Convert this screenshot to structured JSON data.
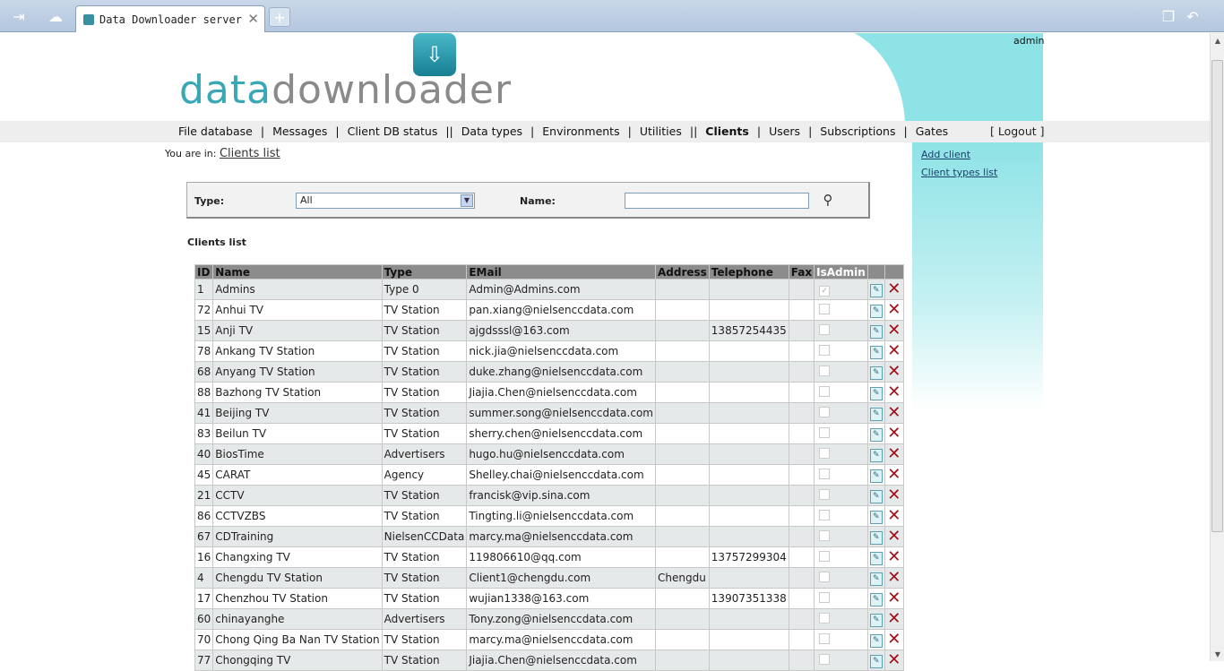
{
  "browser": {
    "tab_title": "Data Downloader server",
    "tab_close": "✕",
    "new_tab": "+"
  },
  "header": {
    "logo_part1": "data",
    "logo_part2": "downloader",
    "user": "admin"
  },
  "nav": {
    "items": [
      {
        "label": "File database",
        "sep": "|"
      },
      {
        "label": "Messages",
        "sep": "|"
      },
      {
        "label": "Client DB status",
        "sep": "||"
      },
      {
        "label": "Data types",
        "sep": "|"
      },
      {
        "label": "Environments",
        "sep": "|"
      },
      {
        "label": "Utilities",
        "sep": "||"
      },
      {
        "label": "Clients",
        "sep": "|"
      },
      {
        "label": "Users",
        "sep": "|"
      },
      {
        "label": "Subscriptions",
        "sep": "|"
      },
      {
        "label": "Gates",
        "sep": ""
      }
    ],
    "active": "Clients",
    "logout": "[ Logout ]"
  },
  "sidebar": {
    "add_client": "Add client",
    "client_types": "Client types list"
  },
  "breadcrumb": {
    "prefix": "You are in:",
    "current": "Clients list"
  },
  "filter": {
    "type_label": "Type:",
    "type_value": "All",
    "name_label": "Name:",
    "name_value": ""
  },
  "list_title": "Clients list",
  "table": {
    "columns": [
      "ID",
      "Name",
      "Type",
      "EMail",
      "Address",
      "Telephone",
      "Fax",
      "IsAdmin",
      "",
      ""
    ],
    "rows": [
      {
        "id": "1",
        "name": "Admins",
        "type": "Type 0",
        "email": "Admin@Admins.com",
        "address": "",
        "telephone": "",
        "fax": "",
        "is_admin": true
      },
      {
        "id": "72",
        "name": "Anhui TV",
        "type": "TV Station",
        "email": "pan.xiang@nielsenccdata.com",
        "address": "",
        "telephone": "",
        "fax": "",
        "is_admin": false
      },
      {
        "id": "15",
        "name": "Anji TV",
        "type": "TV Station",
        "email": "ajgdsssl@163.com",
        "address": "",
        "telephone": "13857254435",
        "fax": "",
        "is_admin": false
      },
      {
        "id": "78",
        "name": "Ankang TV Station",
        "type": "TV Station",
        "email": "nick.jia@nielsenccdata.com",
        "address": "",
        "telephone": "",
        "fax": "",
        "is_admin": false
      },
      {
        "id": "68",
        "name": "Anyang TV Station",
        "type": "TV Station",
        "email": "duke.zhang@nielsenccdata.com",
        "address": "",
        "telephone": "",
        "fax": "",
        "is_admin": false
      },
      {
        "id": "88",
        "name": "Bazhong TV Station",
        "type": "TV Station",
        "email": "Jiajia.Chen@nielsenccdata.com",
        "address": "",
        "telephone": "",
        "fax": "",
        "is_admin": false
      },
      {
        "id": "41",
        "name": "Beijing TV",
        "type": "TV Station",
        "email": "summer.song@nielsenccdata.com",
        "address": "",
        "telephone": "",
        "fax": "",
        "is_admin": false
      },
      {
        "id": "83",
        "name": "Beilun TV",
        "type": "TV Station",
        "email": "sherry.chen@nielsenccdata.com",
        "address": "",
        "telephone": "",
        "fax": "",
        "is_admin": false
      },
      {
        "id": "40",
        "name": "BiosTime",
        "type": "Advertisers",
        "email": "hugo.hu@nielsenccdata.com",
        "address": "",
        "telephone": "",
        "fax": "",
        "is_admin": false
      },
      {
        "id": "45",
        "name": "CARAT",
        "type": "Agency",
        "email": "Shelley.chai@nielsenccdata.com",
        "address": "",
        "telephone": "",
        "fax": "",
        "is_admin": false
      },
      {
        "id": "21",
        "name": "CCTV",
        "type": "TV Station",
        "email": "francisk@vip.sina.com",
        "address": "",
        "telephone": "",
        "fax": "",
        "is_admin": false
      },
      {
        "id": "86",
        "name": "CCTVZBS",
        "type": "TV Station",
        "email": "Tingting.li@nielsenccdata.com",
        "address": "",
        "telephone": "",
        "fax": "",
        "is_admin": false
      },
      {
        "id": "67",
        "name": "CDTraining",
        "type": "NielsenCCData",
        "email": "marcy.ma@nielsenccdata.com",
        "address": "",
        "telephone": "",
        "fax": "",
        "is_admin": false
      },
      {
        "id": "16",
        "name": "Changxing TV",
        "type": "TV Station",
        "email": "119806610@qq.com",
        "address": "",
        "telephone": "13757299304",
        "fax": "",
        "is_admin": false
      },
      {
        "id": "4",
        "name": "Chengdu TV Station",
        "type": "TV Station",
        "email": "Client1@chengdu.com",
        "address": "Chengdu",
        "telephone": "",
        "fax": "",
        "is_admin": false
      },
      {
        "id": "17",
        "name": "Chenzhou TV Station",
        "type": "TV Station",
        "email": "wujian1338@163.com",
        "address": "",
        "telephone": "13907351338",
        "fax": "",
        "is_admin": false
      },
      {
        "id": "60",
        "name": "chinayanghe",
        "type": "Advertisers",
        "email": "Tony.zong@nielsenccdata.com",
        "address": "",
        "telephone": "",
        "fax": "",
        "is_admin": false
      },
      {
        "id": "70",
        "name": "Chong Qing Ba Nan TV Station",
        "type": "TV Station",
        "email": "marcy.ma@nielsenccdata.com",
        "address": "",
        "telephone": "",
        "fax": "",
        "is_admin": false
      },
      {
        "id": "77",
        "name": "Chongqing TV",
        "type": "TV Station",
        "email": "Jiajia.Chen@nielsenccdata.com",
        "address": "",
        "telephone": "",
        "fax": "",
        "is_admin": false
      }
    ]
  }
}
